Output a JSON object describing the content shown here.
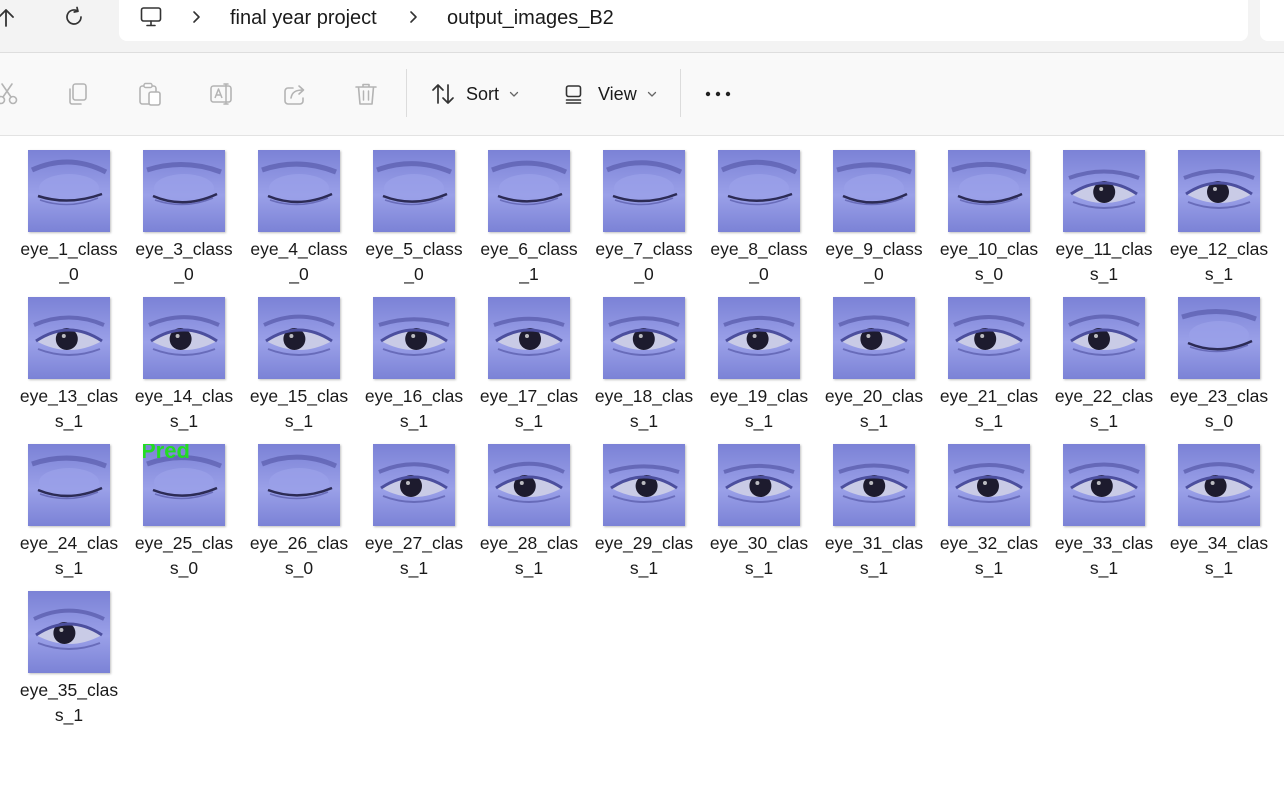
{
  "breadcrumb": {
    "items": [
      "final year project",
      "output_images_B2"
    ]
  },
  "toolbar": {
    "sort_label": "Sort",
    "view_label": "View"
  },
  "files": [
    {
      "line1": "eye_1_class",
      "line2": "_0",
      "state": "closed"
    },
    {
      "line1": "eye_3_class",
      "line2": "_0",
      "state": "closed"
    },
    {
      "line1": "eye_4_class",
      "line2": "_0",
      "state": "closed"
    },
    {
      "line1": "eye_5_class",
      "line2": "_0",
      "state": "closed"
    },
    {
      "line1": "eye_6_class",
      "line2": "_1",
      "state": "closed"
    },
    {
      "line1": "eye_7_class",
      "line2": "_0",
      "state": "closed"
    },
    {
      "line1": "eye_8_class",
      "line2": "_0",
      "state": "closed"
    },
    {
      "line1": "eye_9_class",
      "line2": "_0",
      "state": "closed"
    },
    {
      "line1": "eye_10_clas",
      "line2": "s_0",
      "state": "closed"
    },
    {
      "line1": "eye_11_clas",
      "line2": "s_1",
      "state": "open"
    },
    {
      "line1": "eye_12_clas",
      "line2": "s_1",
      "state": "open"
    },
    {
      "line1": "eye_13_clas",
      "line2": "s_1",
      "state": "open"
    },
    {
      "line1": "eye_14_clas",
      "line2": "s_1",
      "state": "open"
    },
    {
      "line1": "eye_15_clas",
      "line2": "s_1",
      "state": "open"
    },
    {
      "line1": "eye_16_clas",
      "line2": "s_1",
      "state": "open"
    },
    {
      "line1": "eye_17_clas",
      "line2": "s_1",
      "state": "open"
    },
    {
      "line1": "eye_18_clas",
      "line2": "s_1",
      "state": "open"
    },
    {
      "line1": "eye_19_clas",
      "line2": "s_1",
      "state": "open"
    },
    {
      "line1": "eye_20_clas",
      "line2": "s_1",
      "state": "open"
    },
    {
      "line1": "eye_21_clas",
      "line2": "s_1",
      "state": "open"
    },
    {
      "line1": "eye_22_clas",
      "line2": "s_1",
      "state": "open"
    },
    {
      "line1": "eye_23_clas",
      "line2": "s_0",
      "state": "closed"
    },
    {
      "line1": "eye_24_clas",
      "line2": "s_1",
      "state": "closed"
    },
    {
      "line1": "eye_25_clas",
      "line2": "s_0",
      "state": "closed",
      "overlay_text": "Pred"
    },
    {
      "line1": "eye_26_clas",
      "line2": "s_0",
      "state": "closed"
    },
    {
      "line1": "eye_27_clas",
      "line2": "s_1",
      "state": "open"
    },
    {
      "line1": "eye_28_clas",
      "line2": "s_1",
      "state": "open"
    },
    {
      "line1": "eye_29_clas",
      "line2": "s_1",
      "state": "open"
    },
    {
      "line1": "eye_30_clas",
      "line2": "s_1",
      "state": "open"
    },
    {
      "line1": "eye_31_clas",
      "line2": "s_1",
      "state": "open"
    },
    {
      "line1": "eye_32_clas",
      "line2": "s_1",
      "state": "open"
    },
    {
      "line1": "eye_33_clas",
      "line2": "s_1",
      "state": "open"
    },
    {
      "line1": "eye_34_clas",
      "line2": "s_1",
      "state": "open"
    },
    {
      "line1": "eye_35_clas",
      "line2": "s_1",
      "state": "open"
    }
  ],
  "colors": {
    "thumb_skin": "#7b82d6",
    "thumb_skin_light": "#9aa0e8",
    "thumb_shadow": "#4c4f9e",
    "iris": "#1d1b2e",
    "sclera": "#c9cbe6",
    "overlay_text": "#22dd22"
  }
}
